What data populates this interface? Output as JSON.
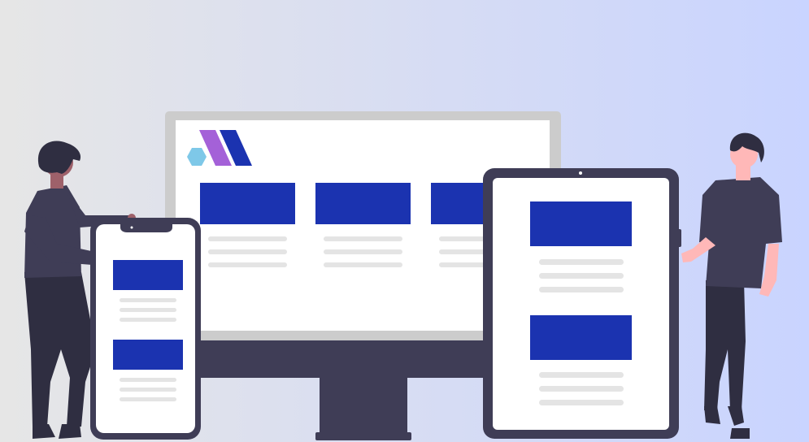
{
  "illustration": {
    "scene": "responsive-design",
    "colors": {
      "background_left": "#e6e6e6",
      "background_right": "#c9d4ff",
      "device_dark": "#3f3d56",
      "screen_bezel_light": "#cccccc",
      "screen_white": "#ffffff",
      "card_blue": "#1b33b0",
      "text_line_gray": "#e4e4e4",
      "logo_purple": "#a461d8",
      "logo_blue": "#1b33b0",
      "logo_hex": "#7ec8e8",
      "skin_dark": "#9e616a",
      "skin_light": "#ffb8b8",
      "hair": "#2f2e41",
      "pants": "#2f2e41"
    },
    "devices": {
      "desktop": {
        "icon": "monitor-icon",
        "cards": 3,
        "text_lines_per_card": 3
      },
      "phone": {
        "icon": "smartphone-icon",
        "cards": 2,
        "text_lines_per_card": 3
      },
      "tablet": {
        "icon": "tablet-icon",
        "cards": 2,
        "text_lines_per_card": 3
      }
    },
    "logo": {
      "icon": "app-logo-icon"
    },
    "people": [
      "person-left",
      "person-right"
    ]
  }
}
